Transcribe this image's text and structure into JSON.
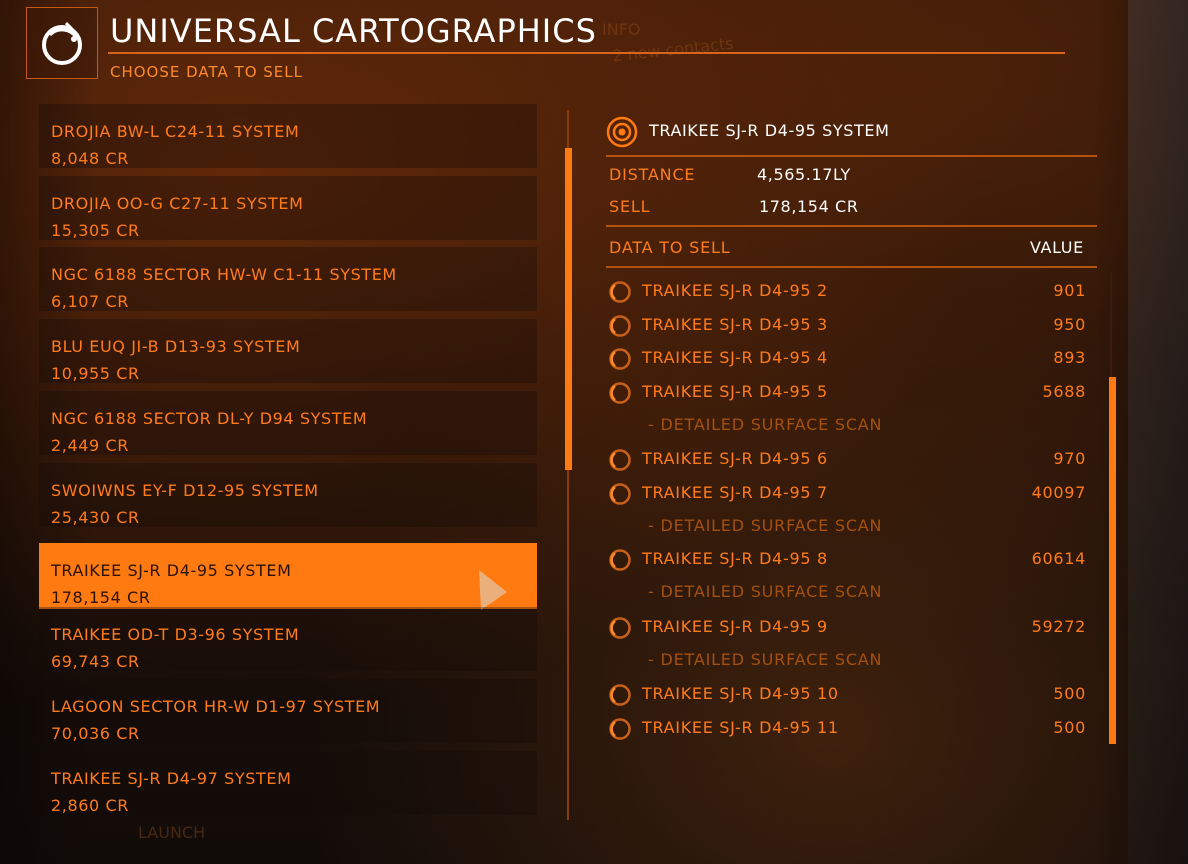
{
  "header": {
    "title": "UNIVERSAL CARTOGRAPHICS",
    "subtitle": "CHOOSE DATA TO SELL",
    "bg_text_info": "INFO",
    "bg_text_contacts": "2 new contacts",
    "bg_text_launch": "LAUNCH"
  },
  "systems": [
    {
      "name": "DROJIA BW-L C24-11 SYSTEM",
      "credits": "8,048 CR"
    },
    {
      "name": "DROJIA OO-G C27-11 SYSTEM",
      "credits": "15,305 CR"
    },
    {
      "name": "NGC 6188 SECTOR HW-W C1-11 SYSTEM",
      "credits": "6,107 CR"
    },
    {
      "name": "BLU EUQ JI-B D13-93 SYSTEM",
      "credits": "10,955 CR"
    },
    {
      "name": "NGC 6188 SECTOR DL-Y D94 SYSTEM",
      "credits": "2,449 CR"
    },
    {
      "name": "SWOIWNS EY-F D12-95 SYSTEM",
      "credits": "25,430 CR"
    },
    {
      "name": "TRAIKEE SJ-R D4-95 SYSTEM",
      "credits": "178,154 CR",
      "selected": true
    },
    {
      "name": "TRAIKEE OD-T D3-96 SYSTEM",
      "credits": "69,743 CR"
    },
    {
      "name": "LAGOON SECTOR HR-W D1-97 SYSTEM",
      "credits": "70,036 CR"
    },
    {
      "name": "TRAIKEE SJ-R D4-97 SYSTEM",
      "credits": "2,860 CR"
    }
  ],
  "detail": {
    "system": "TRAIKEE SJ-R D4-95 SYSTEM",
    "distance_label": "DISTANCE",
    "distance_value": "4,565.17LY",
    "sell_label": "SELL",
    "sell_value": "178,154 CR",
    "data_header": "DATA TO SELL",
    "value_header": "VALUE",
    "items": [
      {
        "name": "TRAIKEE SJ-R D4-95 2",
        "value": "901"
      },
      {
        "name": "TRAIKEE SJ-R D4-95 3",
        "value": "950"
      },
      {
        "name": "TRAIKEE SJ-R D4-95 4",
        "value": "893"
      },
      {
        "name": "TRAIKEE SJ-R D4-95 5",
        "value": "5688",
        "sub": "- DETAILED SURFACE SCAN"
      },
      {
        "name": "TRAIKEE SJ-R D4-95 6",
        "value": "970"
      },
      {
        "name": "TRAIKEE SJ-R D4-95 7",
        "value": "40097",
        "sub": "- DETAILED SURFACE SCAN"
      },
      {
        "name": "TRAIKEE SJ-R D4-95 8",
        "value": "60614",
        "sub": "- DETAILED SURFACE SCAN"
      },
      {
        "name": "TRAIKEE SJ-R D4-95 9",
        "value": "59272",
        "sub": "- DETAILED SURFACE SCAN"
      },
      {
        "name": "TRAIKEE SJ-R D4-95 10",
        "value": "500"
      },
      {
        "name": "TRAIKEE SJ-R D4-95 11",
        "value": "500"
      }
    ]
  },
  "colors": {
    "accent": "#ff7a10",
    "text_orange": "#ff7b1c",
    "sub_text": "#a4500f",
    "white": "#ffffff"
  },
  "icons": {
    "logo": "cartographics-globe-icon",
    "target": "target-icon",
    "item": "scan-circle-icon",
    "cursor": "pointer-cursor-icon"
  }
}
